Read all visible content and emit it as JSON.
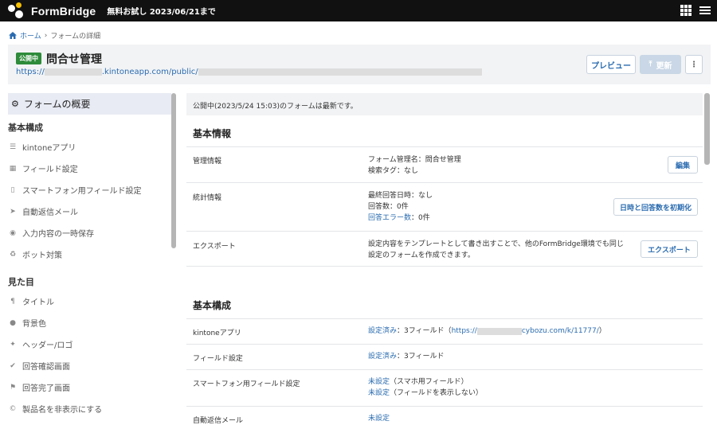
{
  "topbar": {
    "brand": "FormBridge",
    "trial": "無料お試し 2023/06/21まで"
  },
  "breadcrumb": {
    "home": "ホーム",
    "sep": "›",
    "current": "フォームの詳細"
  },
  "header": {
    "status": "公開中",
    "title": "問合せ管理",
    "url_prefix": "https://",
    "url_mid": ".kintoneapp.com/public/",
    "preview_label": "プレビュー",
    "update_label": "更新",
    "more_label": "⋮"
  },
  "sidebar": {
    "active": "フォームの概要",
    "section1": "基本構成",
    "items1": [
      "kintoneアプリ",
      "フィールド設定",
      "スマートフォン用フィールド設定",
      "自動返信メール",
      "入力内容の一時保存",
      "ボット対策"
    ],
    "section2": "見た目",
    "items2": [
      "タイトル",
      "背景色",
      "ヘッダー/ロゴ",
      "回答確認画面",
      "回答完了画面",
      "製品名を非表示にする"
    ]
  },
  "main": {
    "notice": "公開中(2023/5/24 15:03)のフォームは最新です。",
    "basic_info": {
      "title": "基本情報",
      "admin_label": "管理情報",
      "admin_name": "フォーム管理名：問合せ管理",
      "admin_tag": "検索タグ：なし",
      "edit_label": "編集",
      "stats_label": "統計情報",
      "stats_last": "最終回答日時：なし",
      "stats_count": "回答数：0件",
      "stats_error_link": "回答エラー数",
      "stats_error_val": "：0件",
      "reset_label": "日時と回答数を初期化",
      "export_label": "エクスポート",
      "export_desc1": "設定内容をテンプレートとして書き出すことで、他のFormBridge環境でも同じ",
      "export_desc2": "設定のフォームを作成できます。",
      "export_btn": "エクスポート"
    },
    "basic_config": {
      "title": "基本構成",
      "kintone_label": "kintoneアプリ",
      "kintone_link": "設定済み",
      "kintone_val": "：3フィールド（",
      "kintone_url_a": "https://",
      "kintone_url_b": "cybozu.com/k/11777/",
      "kintone_close": "）",
      "field_label": "フィールド設定",
      "field_link": "設定済み",
      "field_val": "：3フィールド",
      "sp_label": "スマートフォン用フィールド設定",
      "sp_link1": "未設定",
      "sp_val1": "（スマホ用フィールド）",
      "sp_link2": "未設定",
      "sp_val2": "（フィールドを表示しない）",
      "mail_label": "自動返信メール",
      "mail_link": "未設定"
    }
  }
}
